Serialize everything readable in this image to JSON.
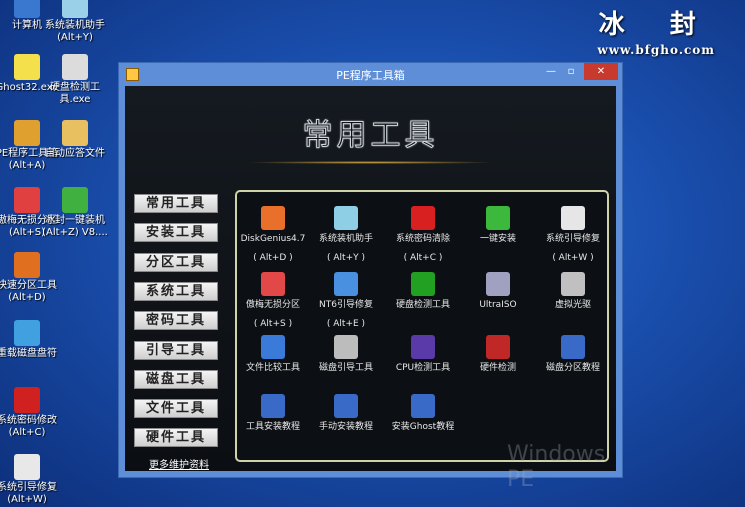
{
  "brand": {
    "name": "冰 封",
    "url": "www.bfgho.com"
  },
  "desktop_icons": [
    {
      "name": "computer",
      "label": "计算机",
      "color": "#3a78d0"
    },
    {
      "name": "sys-install",
      "label": "系统装机助手\n(Alt+Y)",
      "color": "#9ad0e8"
    },
    {
      "name": "ghost32",
      "label": "Ghost32.exe",
      "color": "#f4e04a"
    },
    {
      "name": "disk-check",
      "label": "硬盘检测工\n具.exe",
      "color": "#dcdcdc"
    },
    {
      "name": "pe-toolbox",
      "label": "PE程序工具箱\n(Alt+A)",
      "color": "#e0a030"
    },
    {
      "name": "auto-answer",
      "label": "自动应答文件",
      "color": "#e8c060"
    },
    {
      "name": "lossless-part",
      "label": "傲梅无损分区\n(Alt+S)",
      "color": "#e04040"
    },
    {
      "name": "one-key",
      "label": "冰封一键装机\n(Alt+Z) V8....",
      "color": "#40b040"
    },
    {
      "name": "fast-part",
      "label": "快速分区工具\n(Alt+D)",
      "color": "#e07020"
    },
    {
      "name": "reload-disk",
      "label": "重载磁盘盘符",
      "color": "#40a0e0"
    },
    {
      "name": "pwd-change",
      "label": "系统密码修改\n(Alt+C)",
      "color": "#d02020"
    },
    {
      "name": "boot-repair",
      "label": "系统引导修复\n(Alt+W)",
      "color": "#e8e8e8"
    }
  ],
  "window": {
    "title": "PE程序工具箱",
    "min": "—",
    "max": "▫",
    "close": "✕"
  },
  "heading": "常用工具",
  "sidebar": [
    "常用工具",
    "安装工具",
    "分区工具",
    "系统工具",
    "密码工具",
    "引导工具",
    "磁盘工具",
    "文件工具",
    "硬件工具"
  ],
  "more_link": "更多维护资料",
  "watermark": "Windows PE",
  "tools": [
    {
      "label": "DiskGenius4.7",
      "hotkey": "( Alt+D )",
      "icon": "disk-genius-icon",
      "color": "#e8702a"
    },
    {
      "label": "系统装机助手",
      "hotkey": "( Alt+Y )",
      "icon": "install-helper-icon",
      "color": "#8ecfe6"
    },
    {
      "label": "系统密码清除",
      "hotkey": "( Alt+C )",
      "icon": "password-clear-icon",
      "color": "#d82020"
    },
    {
      "label": "一键安装",
      "hotkey": "",
      "icon": "one-key-install-icon",
      "color": "#3cb83c"
    },
    {
      "label": "系统引导修复",
      "hotkey": "( Alt+W )",
      "icon": "boot-repair-icon",
      "color": "#e6e6e6"
    },
    {
      "label": "傲梅无损分区",
      "hotkey": "( Alt+S )",
      "icon": "lossless-partition-icon",
      "color": "#e24848"
    },
    {
      "label": "NT6引导修复",
      "hotkey": "( Alt+E )",
      "icon": "nt6-repair-icon",
      "color": "#4a90e0"
    },
    {
      "label": "硬盘检测工具",
      "hotkey": "",
      "icon": "disk-check-icon",
      "color": "#22a022"
    },
    {
      "label": "UltraISO",
      "hotkey": "",
      "icon": "ultraiso-icon",
      "color": "#a0a0c0"
    },
    {
      "label": "虚拟光驱",
      "hotkey": "",
      "icon": "virtual-drive-icon",
      "color": "#c0c0c0"
    },
    {
      "label": "文件比较工具",
      "hotkey": "",
      "icon": "file-compare-icon",
      "color": "#3a7ad8"
    },
    {
      "label": "磁盘引导工具",
      "hotkey": "",
      "icon": "disk-boot-icon",
      "color": "#bcbcbc"
    },
    {
      "label": "CPU检测工具",
      "hotkey": "",
      "icon": "cpu-check-icon",
      "color": "#5a3aa8"
    },
    {
      "label": "硬件检测",
      "hotkey": "",
      "icon": "hardware-64-icon",
      "color": "#c02828"
    },
    {
      "label": "磁盘分区教程",
      "hotkey": "",
      "icon": "partition-guide-icon",
      "color": "#3a6ac8"
    },
    {
      "label": "工具安装教程",
      "hotkey": "",
      "icon": "tool-guide-icon",
      "color": "#3a6ac8"
    },
    {
      "label": "手动安装教程",
      "hotkey": "",
      "icon": "manual-guide-icon",
      "color": "#3a6ac8"
    },
    {
      "label": "安装Ghost教程",
      "hotkey": "",
      "icon": "ghost-guide-icon",
      "color": "#3a6ac8"
    }
  ]
}
